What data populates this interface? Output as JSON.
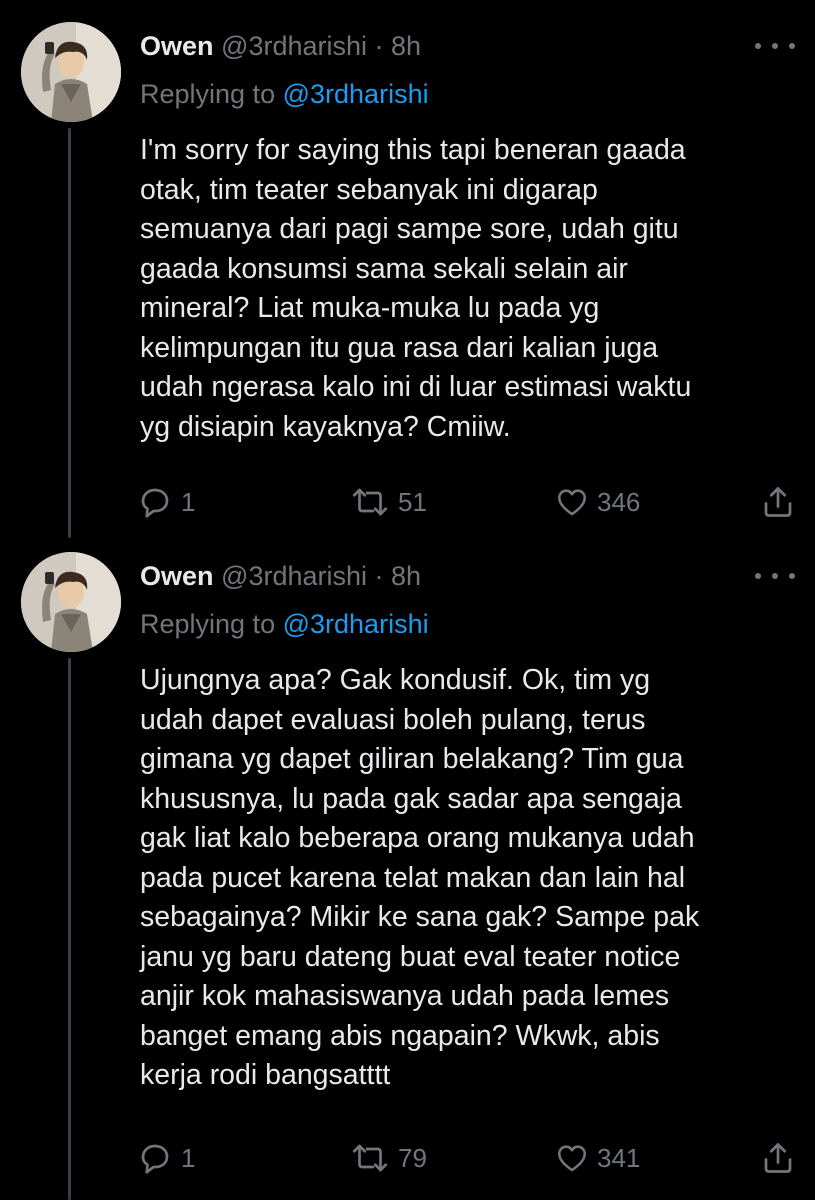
{
  "colors": {
    "background": "#000000",
    "text": "#e7e9ea",
    "muted": "#71767b",
    "link": "#1d9bf0",
    "thread_line": "#3a3f44"
  },
  "tweets": [
    {
      "avatar": "user-avatar",
      "name": "Owen",
      "handle": "@3rdharishi",
      "dot": "·",
      "time": "8h",
      "replying_prefix": "Replying to",
      "replying_handle": "@3rdharishi",
      "text": "I'm sorry for saying this tapi beneran gaada\notak, tim teater sebanyak ini digarap\nsemuanya dari pagi sampe sore, udah gitu\ngaada konsumsi sama sekali selain air\nmineral? Liat muka-muka lu pada yg\nkelimpungan itu gua rasa dari kalian juga\nudah ngerasa kalo ini di luar estimasi waktu\nyg disiapin kayaknya? Cmiiw.",
      "replies": "1",
      "retweets": "51",
      "likes": "346",
      "icons": [
        "reply-icon",
        "retweet-icon",
        "like-icon",
        "share-icon",
        "more-icon"
      ]
    },
    {
      "avatar": "user-avatar",
      "name": "Owen",
      "handle": "@3rdharishi",
      "dot": "·",
      "time": "8h",
      "replying_prefix": "Replying to",
      "replying_handle": "@3rdharishi",
      "text": "Ujungnya apa? Gak kondusif. Ok, tim yg\nudah dapet evaluasi boleh pulang, terus\ngimana yg dapet giliran belakang? Tim gua\nkhususnya, lu pada gak sadar apa sengaja\ngak liat kalo beberapa orang mukanya udah\npada pucet karena telat makan dan lain hal\nsebagainya? Mikir ke sana gak? Sampe pak\njanu yg baru dateng buat eval teater notice\nanjir kok mahasiswanya udah pada lemes\nbanget emang abis ngapain? Wkwk, abis\nkerja rodi bangsatttt",
      "replies": "1",
      "retweets": "79",
      "likes": "341",
      "icons": [
        "reply-icon",
        "retweet-icon",
        "like-icon",
        "share-icon",
        "more-icon"
      ]
    }
  ]
}
